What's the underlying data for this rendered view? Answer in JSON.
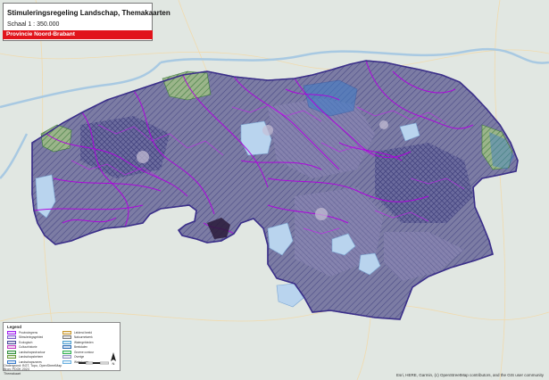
{
  "header": {
    "title": "Stimuleringsregeling Landschap, Themakaarten",
    "scale": "Schaal 1 : 350.000",
    "province": "Provincie Noord-Brabant"
  },
  "legend": {
    "title": "Legend",
    "items_left": [
      {
        "label": "Provinciegrens",
        "color": "#a020f0"
      },
      {
        "label": "Stimuleringsgebied",
        "color": "#7b5cc9"
      },
      {
        "label": "Ecologisch",
        "color": "#4a4a9c"
      },
      {
        "label": "Cultuurhistorie",
        "color": "#c040c0"
      },
      {
        "label": "Landschapsstructuur",
        "color": "#2f8f3a"
      },
      {
        "label": "Landschapsbeheer",
        "color": "#6a9a3a"
      },
      {
        "label": "Landschapszones",
        "color": "#3d7dca"
      }
    ],
    "items_right": [
      {
        "label": "Leidend beeld",
        "color": "#c8962a"
      },
      {
        "label": "Natuurnetwerk",
        "color": "#7a7a7a"
      },
      {
        "label": "Watergebieden",
        "color": "#4c9fd0"
      },
      {
        "label": "Beekdalen",
        "color": "#2c6db4"
      },
      {
        "label": "Groene contour",
        "color": "#30b050"
      },
      {
        "label": "Overige",
        "color": "#9090c0"
      },
      {
        "label": "Waterlopen",
        "color": "#6ab0e0"
      }
    ],
    "credit_lines": [
      "Ondergrond: BGT, Topo, OpenStreetMap",
      "Bron: PDOK 2024",
      "Themakaart"
    ]
  },
  "attribution": "Esri, HERE, Garmin, (c) OpenStreetMap contributors, and the GIS user community",
  "colors": {
    "province_fill": "#6d6d9a",
    "boundary": "#b000e0",
    "accent": "#e1141b",
    "water": "#b7d7ef",
    "background": "#dfe6e2"
  }
}
